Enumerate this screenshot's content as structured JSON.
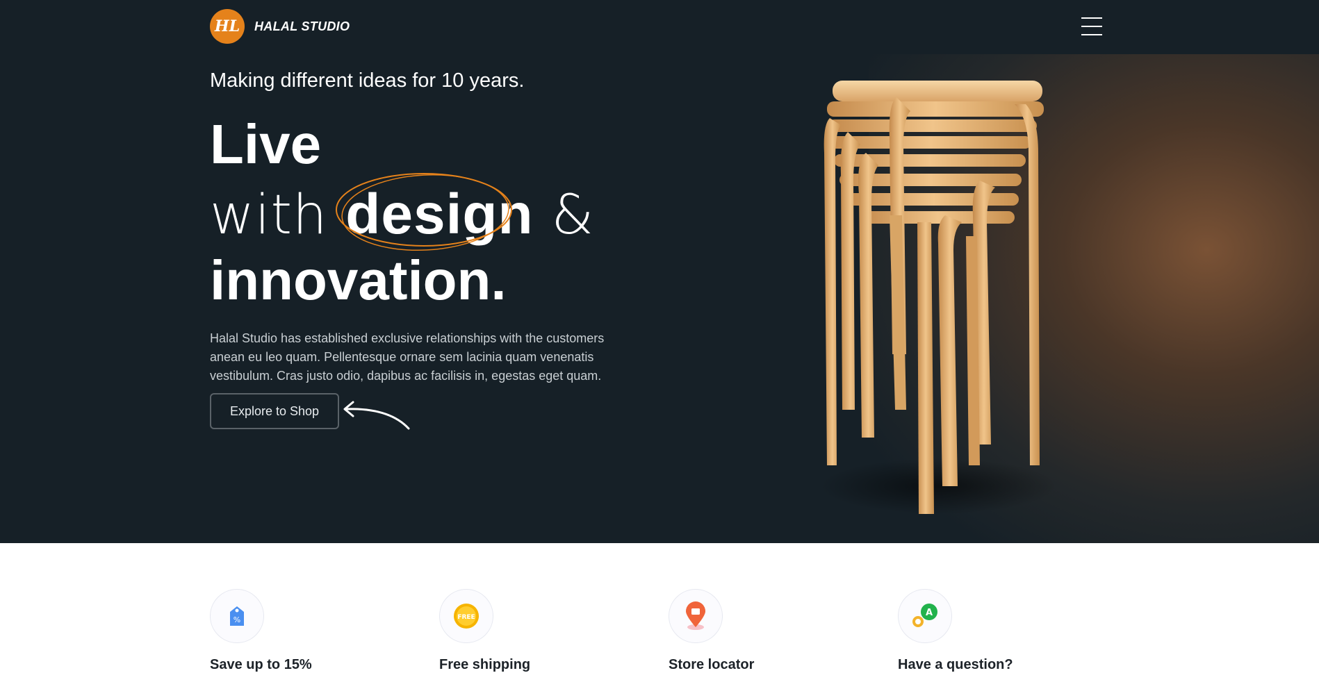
{
  "brand": {
    "logo_mark": "HL",
    "name": "HALAL STUDIO",
    "accent": "#e5821b",
    "bg": "#162027"
  },
  "nav": {
    "menu_icon": "hamburger-menu-icon"
  },
  "hero": {
    "tagline": "Making different ideas for 10 years.",
    "line1": "Live",
    "line2_pre": "with",
    "line2_bold": "design",
    "line2_post": "&",
    "line3": "innovation.",
    "description": "Halal Studio has established exclusive relationships with the customers anean eu leo quam. Pellentesque ornare sem lacinia quam venenatis vestibulum. Cras justo odio, dapibus ac facilisis in, egestas eget quam.",
    "cta": "Explore to Shop",
    "image": "stacked-wooden-stools"
  },
  "features": [
    {
      "title": "Save up to 15%",
      "icon": "discount-tag-icon"
    },
    {
      "title": "Free shipping",
      "icon": "free-badge-icon",
      "badge": "FREE"
    },
    {
      "title": "Store locator",
      "icon": "store-location-pin-icon"
    },
    {
      "title": "Have a question?",
      "icon": "question-chat-icon",
      "badge": "A"
    }
  ]
}
